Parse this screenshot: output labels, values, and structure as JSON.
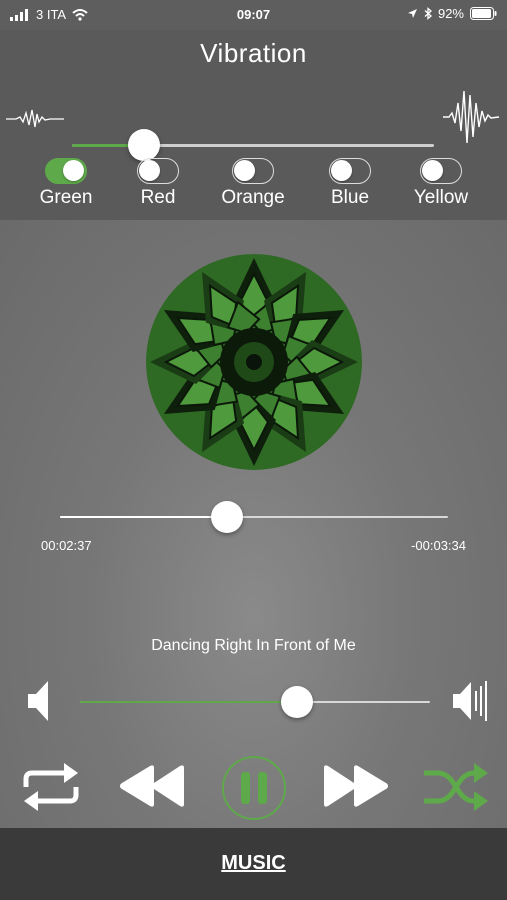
{
  "status_bar": {
    "carrier": "3 ITA",
    "time": "09:07",
    "battery": "92%",
    "icons": [
      "signal-icon",
      "wifi-icon",
      "location-icon",
      "bluetooth-icon",
      "battery-icon"
    ]
  },
  "vibration": {
    "title": "Vibration",
    "level": 0.2,
    "accent": "#5ea94a"
  },
  "colors": [
    {
      "label": "Green",
      "on": true
    },
    {
      "label": "Red",
      "on": false
    },
    {
      "label": "Orange",
      "on": false
    },
    {
      "label": "Blue",
      "on": false
    },
    {
      "label": "Yellow",
      "on": false
    }
  ],
  "player": {
    "elapsed": "00:02:37",
    "remaining": "-00:03:34",
    "progress": 0.43,
    "song_title": "Dancing Right In Front of Me",
    "volume": 0.62,
    "shuffle_on": true,
    "repeat_on": false,
    "playing": true
  },
  "tabs": {
    "music": "MUSIC"
  }
}
